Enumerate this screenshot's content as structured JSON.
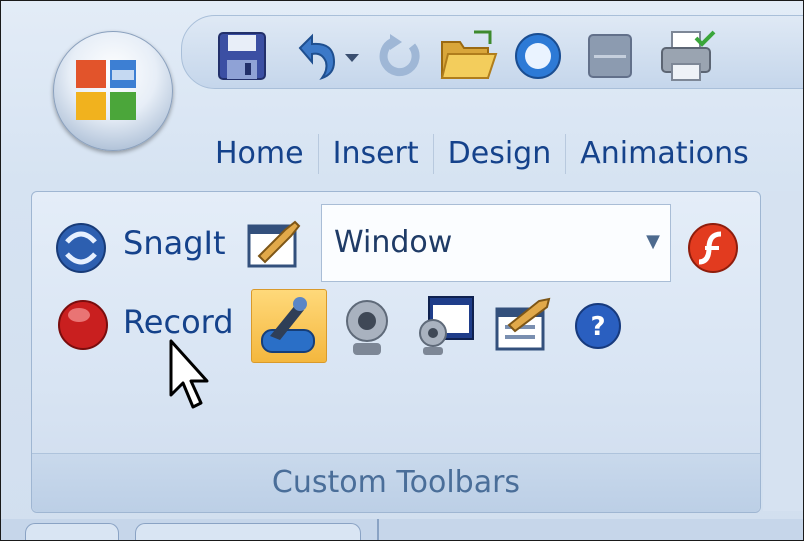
{
  "ribbon": {
    "tabs": [
      "Home",
      "Insert",
      "Design",
      "Animations"
    ],
    "group_label": "Custom Toolbars",
    "snagit_label": "SnagIt",
    "record_label": "Record",
    "capture_mode": {
      "selected": "Window"
    }
  },
  "icons": {
    "quick_access": [
      "save-icon",
      "undo-icon",
      "undo-dropdown-icon",
      "redo-icon",
      "open-folder-icon",
      "circle-icon",
      "blank-icon",
      "print-icon"
    ],
    "row1": [
      "snagit-icon",
      "snagit-profile-icon",
      "flash-icon"
    ],
    "row2": [
      "record-icon",
      "record-settings-icon",
      "webcam-icon",
      "webcam-screen-icon",
      "record-profile-icon",
      "help-icon"
    ]
  }
}
